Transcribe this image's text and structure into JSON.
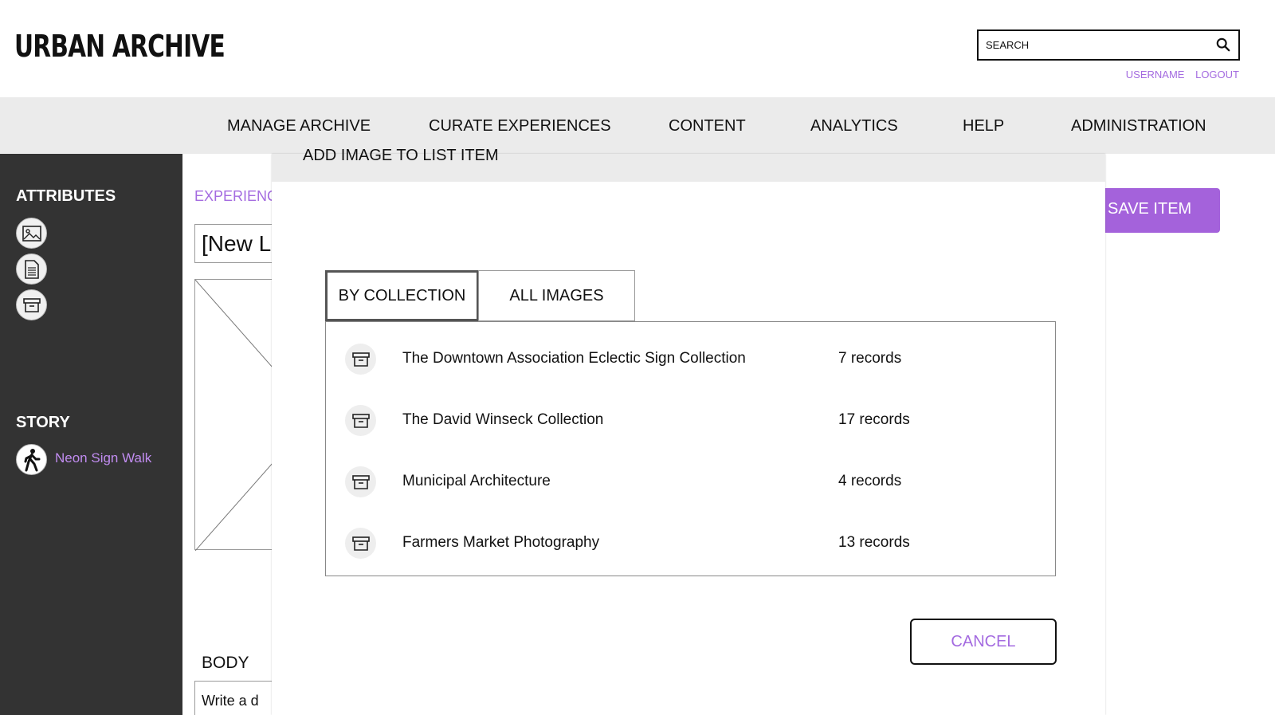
{
  "app": {
    "logo_text": "URBAN ARCHIVE",
    "search_placeholder": "SEARCH",
    "username_label": "USERNAME",
    "logout_label": "LOGOUT"
  },
  "topnav": {
    "items": [
      "MANAGE ARCHIVE",
      "CURATE EXPERIENCES",
      "CONTENT",
      "ANALYTICS",
      "HELP",
      "ADMINISTRATION"
    ]
  },
  "sidebar": {
    "attributes_heading": "ATTRIBUTES",
    "attribute_icons": [
      "image-icon",
      "document-icon",
      "archive-box-icon"
    ],
    "story_heading": "STORY",
    "story_link": "Neon Sign Walk"
  },
  "editor": {
    "breadcrumb": "EXPERIENC",
    "title_value": "[New L",
    "body_label": "BODY",
    "body_placeholder": "Write a d",
    "save_label": "SAVE ITEM"
  },
  "modal": {
    "title": "ADD IMAGE TO LIST ITEM",
    "tabs": [
      "BY COLLECTION",
      "ALL IMAGES"
    ],
    "active_tab": "BY COLLECTION",
    "collections": [
      {
        "name": "The Downtown Association Eclectic Sign Collection",
        "count": "7 records"
      },
      {
        "name": "The David Winseck Collection",
        "count": "17 records"
      },
      {
        "name": "Municipal Architecture",
        "count": "4 records"
      },
      {
        "name": "Farmers Market Photography",
        "count": "13 records"
      }
    ],
    "cancel_label": "CANCEL"
  },
  "colors": {
    "accent_purple": "#a462db",
    "link_purple": "#a46be0",
    "sidebar_bg": "#333333",
    "nav_bg": "#ebebeb"
  }
}
